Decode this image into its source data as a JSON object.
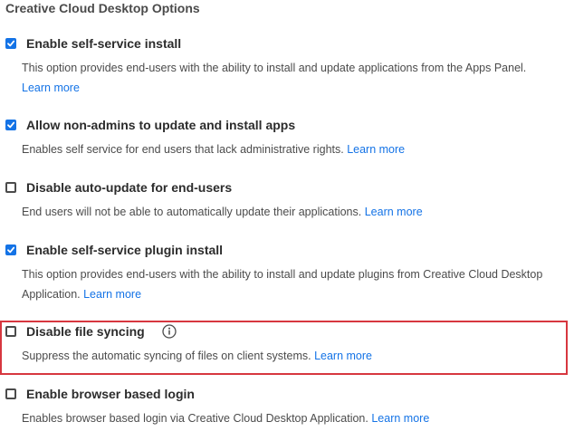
{
  "section_title": "Creative Cloud Desktop Options",
  "options": [
    {
      "label": "Enable self-service install",
      "checked": true,
      "description": "This option provides end-users with the ability to install and update applications from the Apps Panel.",
      "link": "Learn more"
    },
    {
      "label": "Allow non-admins to update and install apps",
      "checked": true,
      "description": "Enables self service for end users that lack administrative rights.",
      "link": "Learn more"
    },
    {
      "label": "Disable auto-update for end-users",
      "checked": false,
      "description": "End users will not be able to automatically update their applications.",
      "link": "Learn more"
    },
    {
      "label": "Enable self-service plugin install",
      "checked": true,
      "description": "This option provides end-users with the ability to install and update plugins from Creative Cloud Desktop Application.",
      "link": "Learn more"
    },
    {
      "label": "Disable file syncing",
      "checked": false,
      "info_icon": "info-icon",
      "highlighted": true,
      "description": "Suppress the automatic syncing of files on client systems.",
      "link": "Learn more"
    },
    {
      "label": "Enable browser based login",
      "checked": false,
      "description": "Enables browser based login via Creative Cloud Desktop Application.",
      "link": "Learn more"
    }
  ],
  "colors": {
    "checkbox_checked": "#1473e6",
    "link": "#1473e6",
    "highlight_border": "#d7373f"
  }
}
